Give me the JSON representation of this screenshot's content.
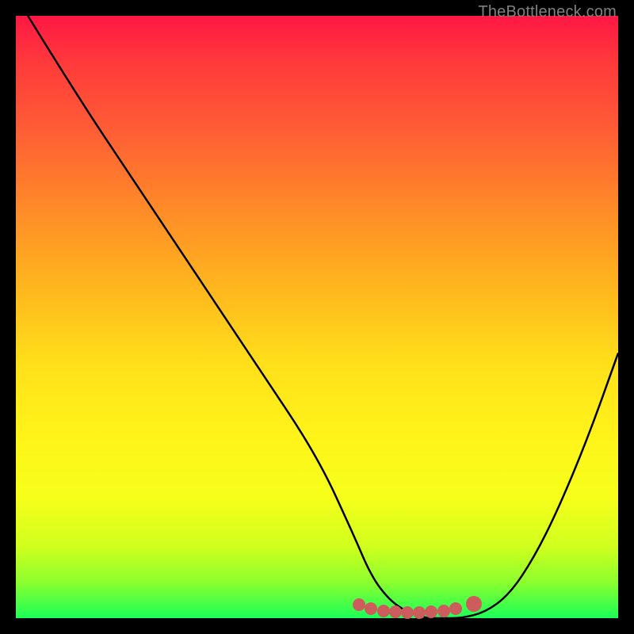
{
  "watermark": "TheBottleneck.com",
  "chart_data": {
    "type": "line",
    "title": "",
    "xlabel": "",
    "ylabel": "",
    "xlim": [
      0,
      100
    ],
    "ylim": [
      0,
      100
    ],
    "series": [
      {
        "name": "curve",
        "x": [
          2,
          10,
          20,
          30,
          40,
          50,
          56,
          59,
          62,
          65,
          68,
          71,
          74,
          78,
          82,
          86,
          90,
          95,
          100
        ],
        "y": [
          100,
          87,
          72,
          57,
          42,
          27,
          14,
          7,
          3,
          1,
          0,
          0,
          0,
          1,
          4,
          10,
          18,
          30,
          44
        ]
      }
    ],
    "markers": {
      "name": "bottom-markers",
      "color": "#cd5c5c",
      "points": [
        {
          "x": 57,
          "y": 2.2
        },
        {
          "x": 59,
          "y": 1.6
        },
        {
          "x": 61,
          "y": 1.2
        },
        {
          "x": 63,
          "y": 1.0
        },
        {
          "x": 65,
          "y": 0.9
        },
        {
          "x": 67,
          "y": 0.9
        },
        {
          "x": 69,
          "y": 1.0
        },
        {
          "x": 71,
          "y": 1.2
        },
        {
          "x": 73,
          "y": 1.6
        },
        {
          "x": 76,
          "y": 2.4,
          "big": true
        }
      ]
    },
    "background_gradient": {
      "top": "#ff1744",
      "mid": "#ffe01a",
      "bottom": "#1cff58"
    }
  }
}
